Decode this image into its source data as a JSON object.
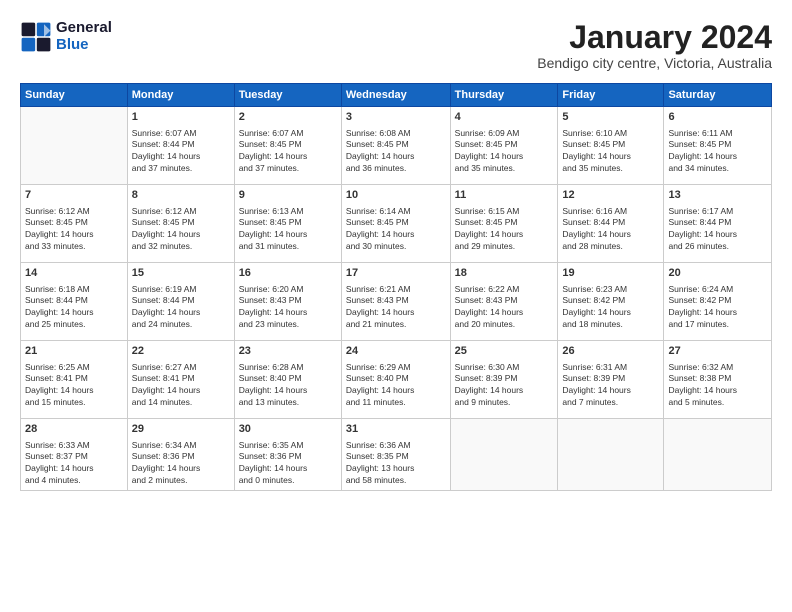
{
  "logo": {
    "line1": "General",
    "line2": "Blue"
  },
  "title": "January 2024",
  "subtitle": "Bendigo city centre, Victoria, Australia",
  "days_header": [
    "Sunday",
    "Monday",
    "Tuesday",
    "Wednesday",
    "Thursday",
    "Friday",
    "Saturday"
  ],
  "weeks": [
    [
      {
        "num": "",
        "text": ""
      },
      {
        "num": "1",
        "text": "Sunrise: 6:07 AM\nSunset: 8:44 PM\nDaylight: 14 hours\nand 37 minutes."
      },
      {
        "num": "2",
        "text": "Sunrise: 6:07 AM\nSunset: 8:45 PM\nDaylight: 14 hours\nand 37 minutes."
      },
      {
        "num": "3",
        "text": "Sunrise: 6:08 AM\nSunset: 8:45 PM\nDaylight: 14 hours\nand 36 minutes."
      },
      {
        "num": "4",
        "text": "Sunrise: 6:09 AM\nSunset: 8:45 PM\nDaylight: 14 hours\nand 35 minutes."
      },
      {
        "num": "5",
        "text": "Sunrise: 6:10 AM\nSunset: 8:45 PM\nDaylight: 14 hours\nand 35 minutes."
      },
      {
        "num": "6",
        "text": "Sunrise: 6:11 AM\nSunset: 8:45 PM\nDaylight: 14 hours\nand 34 minutes."
      }
    ],
    [
      {
        "num": "7",
        "text": "Sunrise: 6:12 AM\nSunset: 8:45 PM\nDaylight: 14 hours\nand 33 minutes."
      },
      {
        "num": "8",
        "text": "Sunrise: 6:12 AM\nSunset: 8:45 PM\nDaylight: 14 hours\nand 32 minutes."
      },
      {
        "num": "9",
        "text": "Sunrise: 6:13 AM\nSunset: 8:45 PM\nDaylight: 14 hours\nand 31 minutes."
      },
      {
        "num": "10",
        "text": "Sunrise: 6:14 AM\nSunset: 8:45 PM\nDaylight: 14 hours\nand 30 minutes."
      },
      {
        "num": "11",
        "text": "Sunrise: 6:15 AM\nSunset: 8:45 PM\nDaylight: 14 hours\nand 29 minutes."
      },
      {
        "num": "12",
        "text": "Sunrise: 6:16 AM\nSunset: 8:44 PM\nDaylight: 14 hours\nand 28 minutes."
      },
      {
        "num": "13",
        "text": "Sunrise: 6:17 AM\nSunset: 8:44 PM\nDaylight: 14 hours\nand 26 minutes."
      }
    ],
    [
      {
        "num": "14",
        "text": "Sunrise: 6:18 AM\nSunset: 8:44 PM\nDaylight: 14 hours\nand 25 minutes."
      },
      {
        "num": "15",
        "text": "Sunrise: 6:19 AM\nSunset: 8:44 PM\nDaylight: 14 hours\nand 24 minutes."
      },
      {
        "num": "16",
        "text": "Sunrise: 6:20 AM\nSunset: 8:43 PM\nDaylight: 14 hours\nand 23 minutes."
      },
      {
        "num": "17",
        "text": "Sunrise: 6:21 AM\nSunset: 8:43 PM\nDaylight: 14 hours\nand 21 minutes."
      },
      {
        "num": "18",
        "text": "Sunrise: 6:22 AM\nSunset: 8:43 PM\nDaylight: 14 hours\nand 20 minutes."
      },
      {
        "num": "19",
        "text": "Sunrise: 6:23 AM\nSunset: 8:42 PM\nDaylight: 14 hours\nand 18 minutes."
      },
      {
        "num": "20",
        "text": "Sunrise: 6:24 AM\nSunset: 8:42 PM\nDaylight: 14 hours\nand 17 minutes."
      }
    ],
    [
      {
        "num": "21",
        "text": "Sunrise: 6:25 AM\nSunset: 8:41 PM\nDaylight: 14 hours\nand 15 minutes."
      },
      {
        "num": "22",
        "text": "Sunrise: 6:27 AM\nSunset: 8:41 PM\nDaylight: 14 hours\nand 14 minutes."
      },
      {
        "num": "23",
        "text": "Sunrise: 6:28 AM\nSunset: 8:40 PM\nDaylight: 14 hours\nand 13 minutes."
      },
      {
        "num": "24",
        "text": "Sunrise: 6:29 AM\nSunset: 8:40 PM\nDaylight: 14 hours\nand 11 minutes."
      },
      {
        "num": "25",
        "text": "Sunrise: 6:30 AM\nSunset: 8:39 PM\nDaylight: 14 hours\nand 9 minutes."
      },
      {
        "num": "26",
        "text": "Sunrise: 6:31 AM\nSunset: 8:39 PM\nDaylight: 14 hours\nand 7 minutes."
      },
      {
        "num": "27",
        "text": "Sunrise: 6:32 AM\nSunset: 8:38 PM\nDaylight: 14 hours\nand 5 minutes."
      }
    ],
    [
      {
        "num": "28",
        "text": "Sunrise: 6:33 AM\nSunset: 8:37 PM\nDaylight: 14 hours\nand 4 minutes."
      },
      {
        "num": "29",
        "text": "Sunrise: 6:34 AM\nSunset: 8:36 PM\nDaylight: 14 hours\nand 2 minutes."
      },
      {
        "num": "30",
        "text": "Sunrise: 6:35 AM\nSunset: 8:36 PM\nDaylight: 14 hours\nand 0 minutes."
      },
      {
        "num": "31",
        "text": "Sunrise: 6:36 AM\nSunset: 8:35 PM\nDaylight: 13 hours\nand 58 minutes."
      },
      {
        "num": "",
        "text": ""
      },
      {
        "num": "",
        "text": ""
      },
      {
        "num": "",
        "text": ""
      }
    ]
  ]
}
